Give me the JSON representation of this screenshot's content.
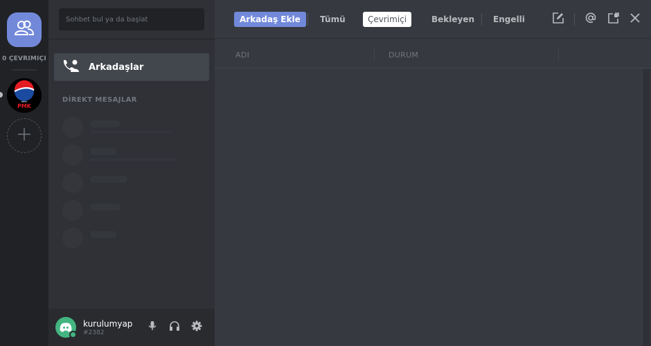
{
  "guilds": {
    "online_count": "0 ÇEVRIMIÇI",
    "server_icon_text": "PEPSI",
    "server_sub_text": "PMK"
  },
  "channels": {
    "search_placeholder": "Sohbet bul ya da başlat",
    "friends_label": "Arkadaşlar",
    "dm_header": "DİREKT MESAJLAR"
  },
  "user": {
    "username": "kurulumyap",
    "discriminator": "#2382"
  },
  "topbar": {
    "add_friend": "Arkadaş Ekle",
    "tab_all": "Tümü",
    "tab_online": "Çevrimiçi",
    "tab_pending": "Bekleyen",
    "tab_blocked": "Engelli"
  },
  "columns": {
    "name": "ADI",
    "status": "DURUM"
  },
  "colors": {
    "blurple": "#7289da",
    "online": "#43b581",
    "bg_dark": "#202225",
    "bg_mid": "#2f3136",
    "bg_main": "#36393f"
  }
}
